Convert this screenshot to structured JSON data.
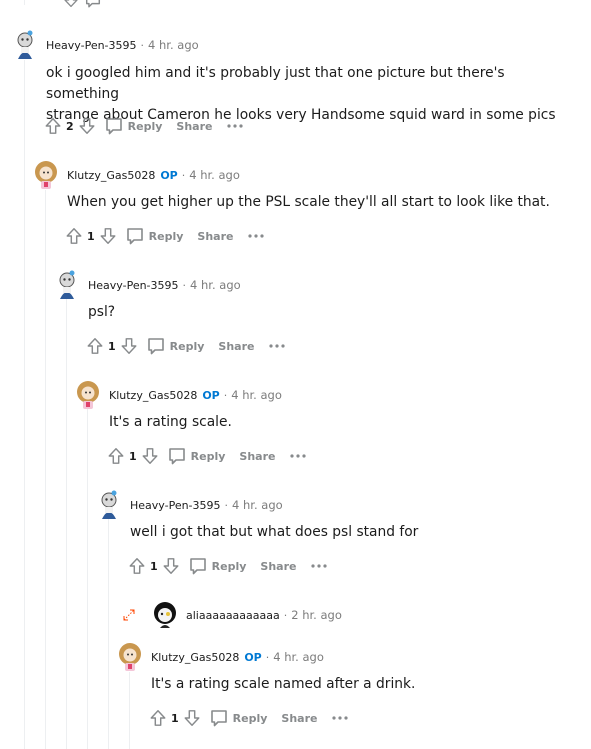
{
  "labels": {
    "reply": "Reply",
    "share": "Share",
    "op": "OP",
    "separator": "·"
  },
  "comments": [
    {
      "author": "Heavy-Pen-3595",
      "time": "4 hr. ago",
      "lines": [
        "ok i googled him and it's probably just that one picture but there's something",
        "strange about Cameron he looks very Handsome squid ward in some pics"
      ],
      "score": "2"
    },
    {
      "author": "Klutzy_Gas5028",
      "time": "4 hr. ago",
      "lines": [
        "When you get higher up the PSL scale they'll all start to look like that."
      ],
      "score": "1"
    },
    {
      "author": "Heavy-Pen-3595",
      "time": "4 hr. ago",
      "lines": [
        "psl?"
      ],
      "score": "1"
    },
    {
      "author": "Klutzy_Gas5028",
      "time": "4 hr. ago",
      "lines": [
        "It's a rating scale."
      ],
      "score": "1"
    },
    {
      "author": "Heavy-Pen-3595",
      "time": "4 hr. ago",
      "lines": [
        "well i got that but what does psl stand for"
      ],
      "score": "1"
    },
    {
      "author": "aliaaaaaaaaaaaa",
      "time": "2 hr. ago"
    },
    {
      "author": "Klutzy_Gas5028",
      "time": "4 hr. ago",
      "lines": [
        "It's a rating scale named after a drink."
      ],
      "score": "1"
    }
  ],
  "colors": {
    "op": "#0079d3",
    "meta": "#7c7c7c",
    "action": "#878a8c",
    "thread_line": "#edeff1"
  }
}
